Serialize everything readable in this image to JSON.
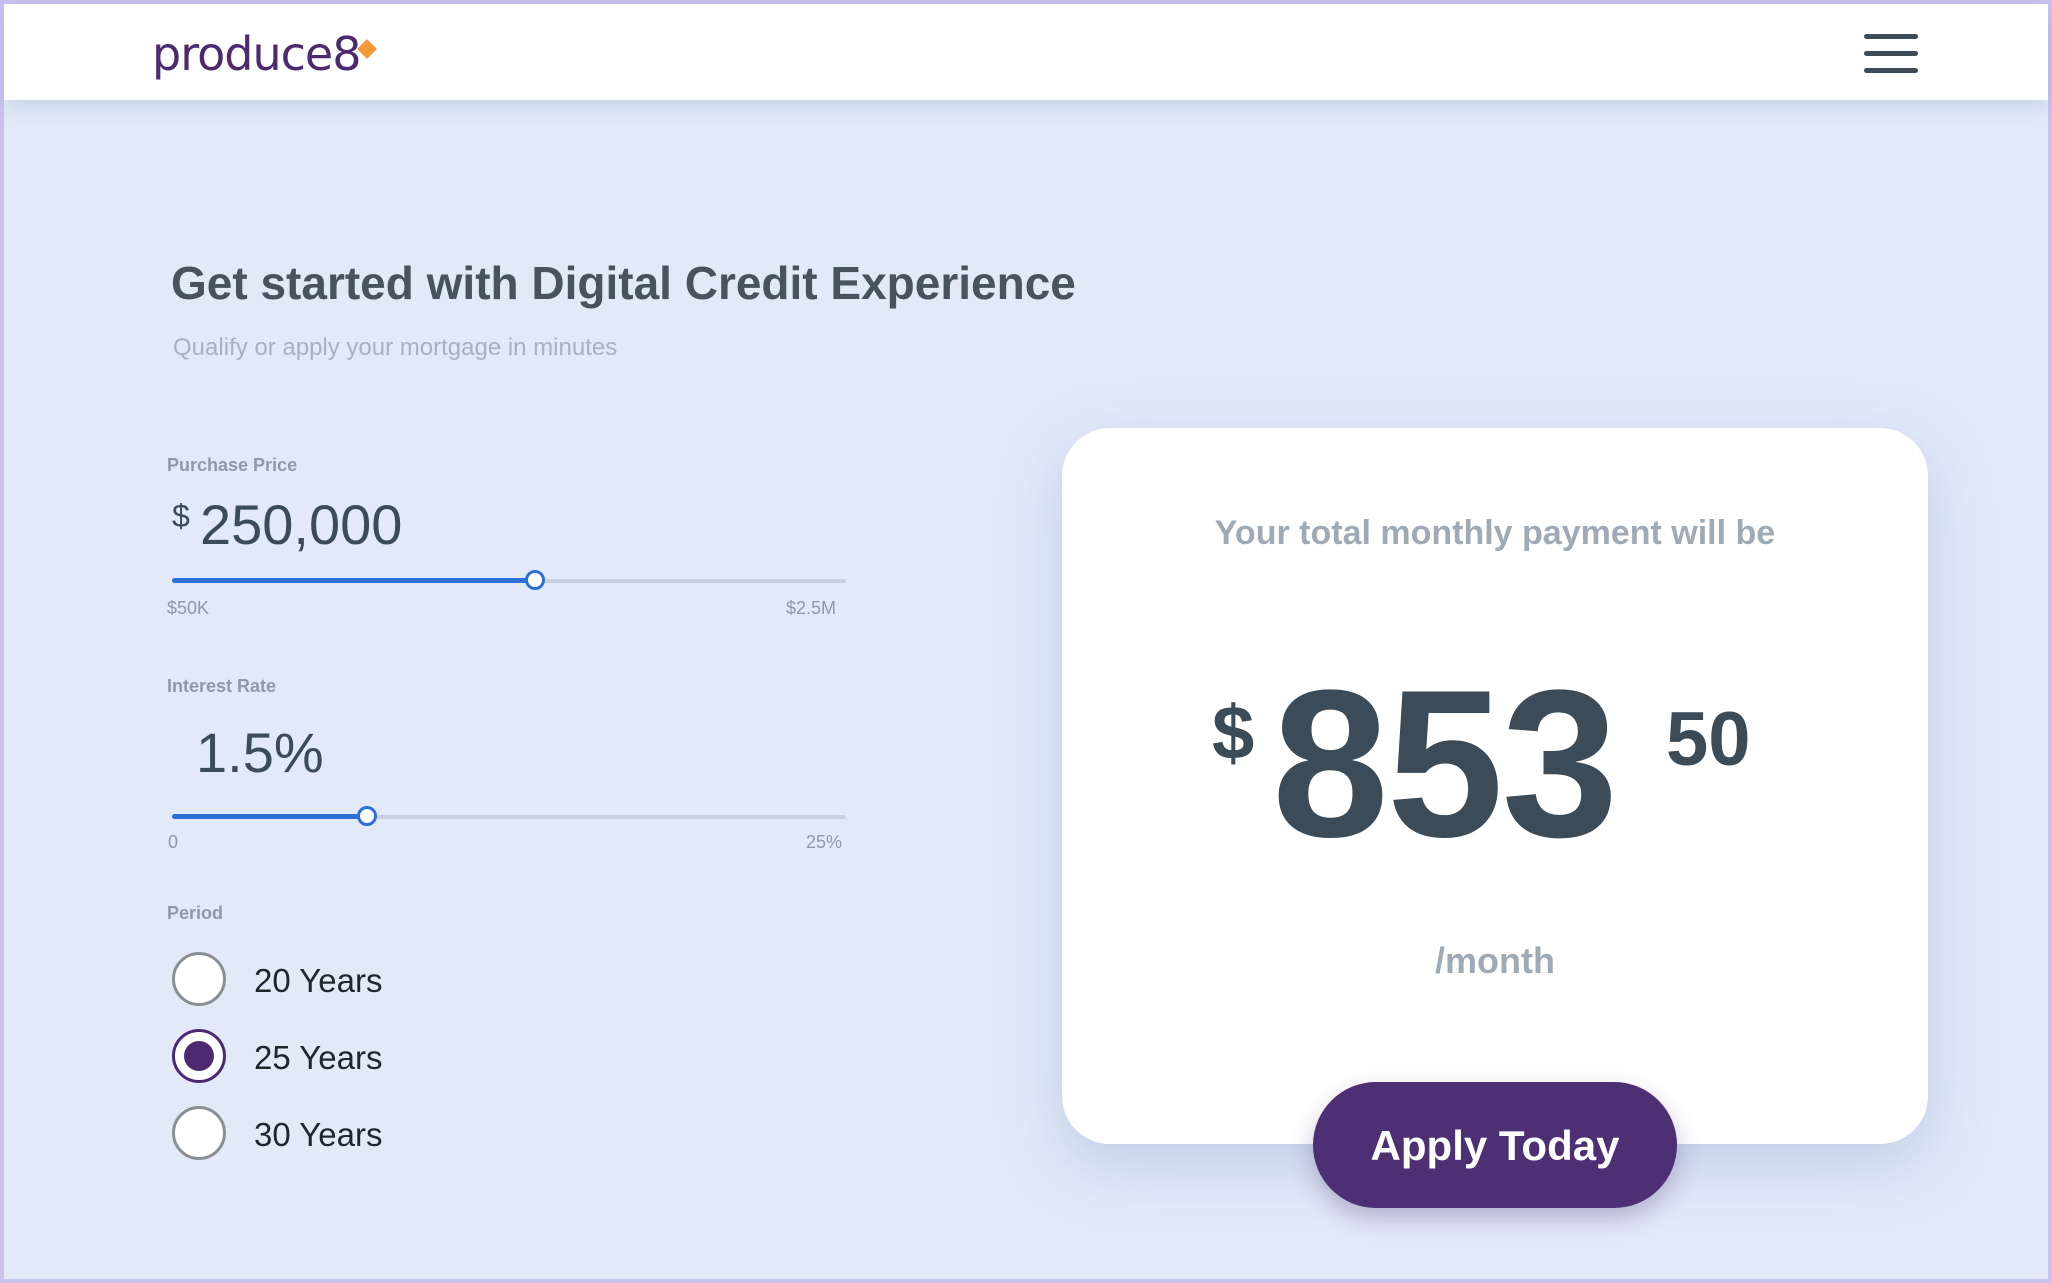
{
  "header": {
    "logo_text": "produce8",
    "brand_color": "#4d2a6f",
    "accent_color": "#f39a36",
    "menu_icon": "hamburger-menu-icon"
  },
  "hero": {
    "title": "Get started with Digital Credit Experience",
    "subtitle": "Qualify or apply your mortgage in minutes"
  },
  "calculator": {
    "purchase_price": {
      "label": "Purchase Price",
      "currency_symbol": "$",
      "value": "250,000",
      "min_label": "$50K",
      "max_label": "$2.5M",
      "slider_fill_percent": 54
    },
    "interest_rate": {
      "label": "Interest Rate",
      "value": "1.5%",
      "min_label": "0",
      "max_label": "25%",
      "slider_fill_percent": 29
    },
    "period": {
      "label": "Period",
      "options": [
        {
          "label": "20 Years",
          "selected": false
        },
        {
          "label": "25 Years",
          "selected": true
        },
        {
          "label": "30 Years",
          "selected": false
        }
      ]
    }
  },
  "result": {
    "heading": "Your total monthly payment will be",
    "currency_symbol": "$",
    "amount_whole": "853",
    "amount_cents": "50",
    "per_label": "/month",
    "cta_label": "Apply Today",
    "cta_color": "#4d2f74"
  }
}
